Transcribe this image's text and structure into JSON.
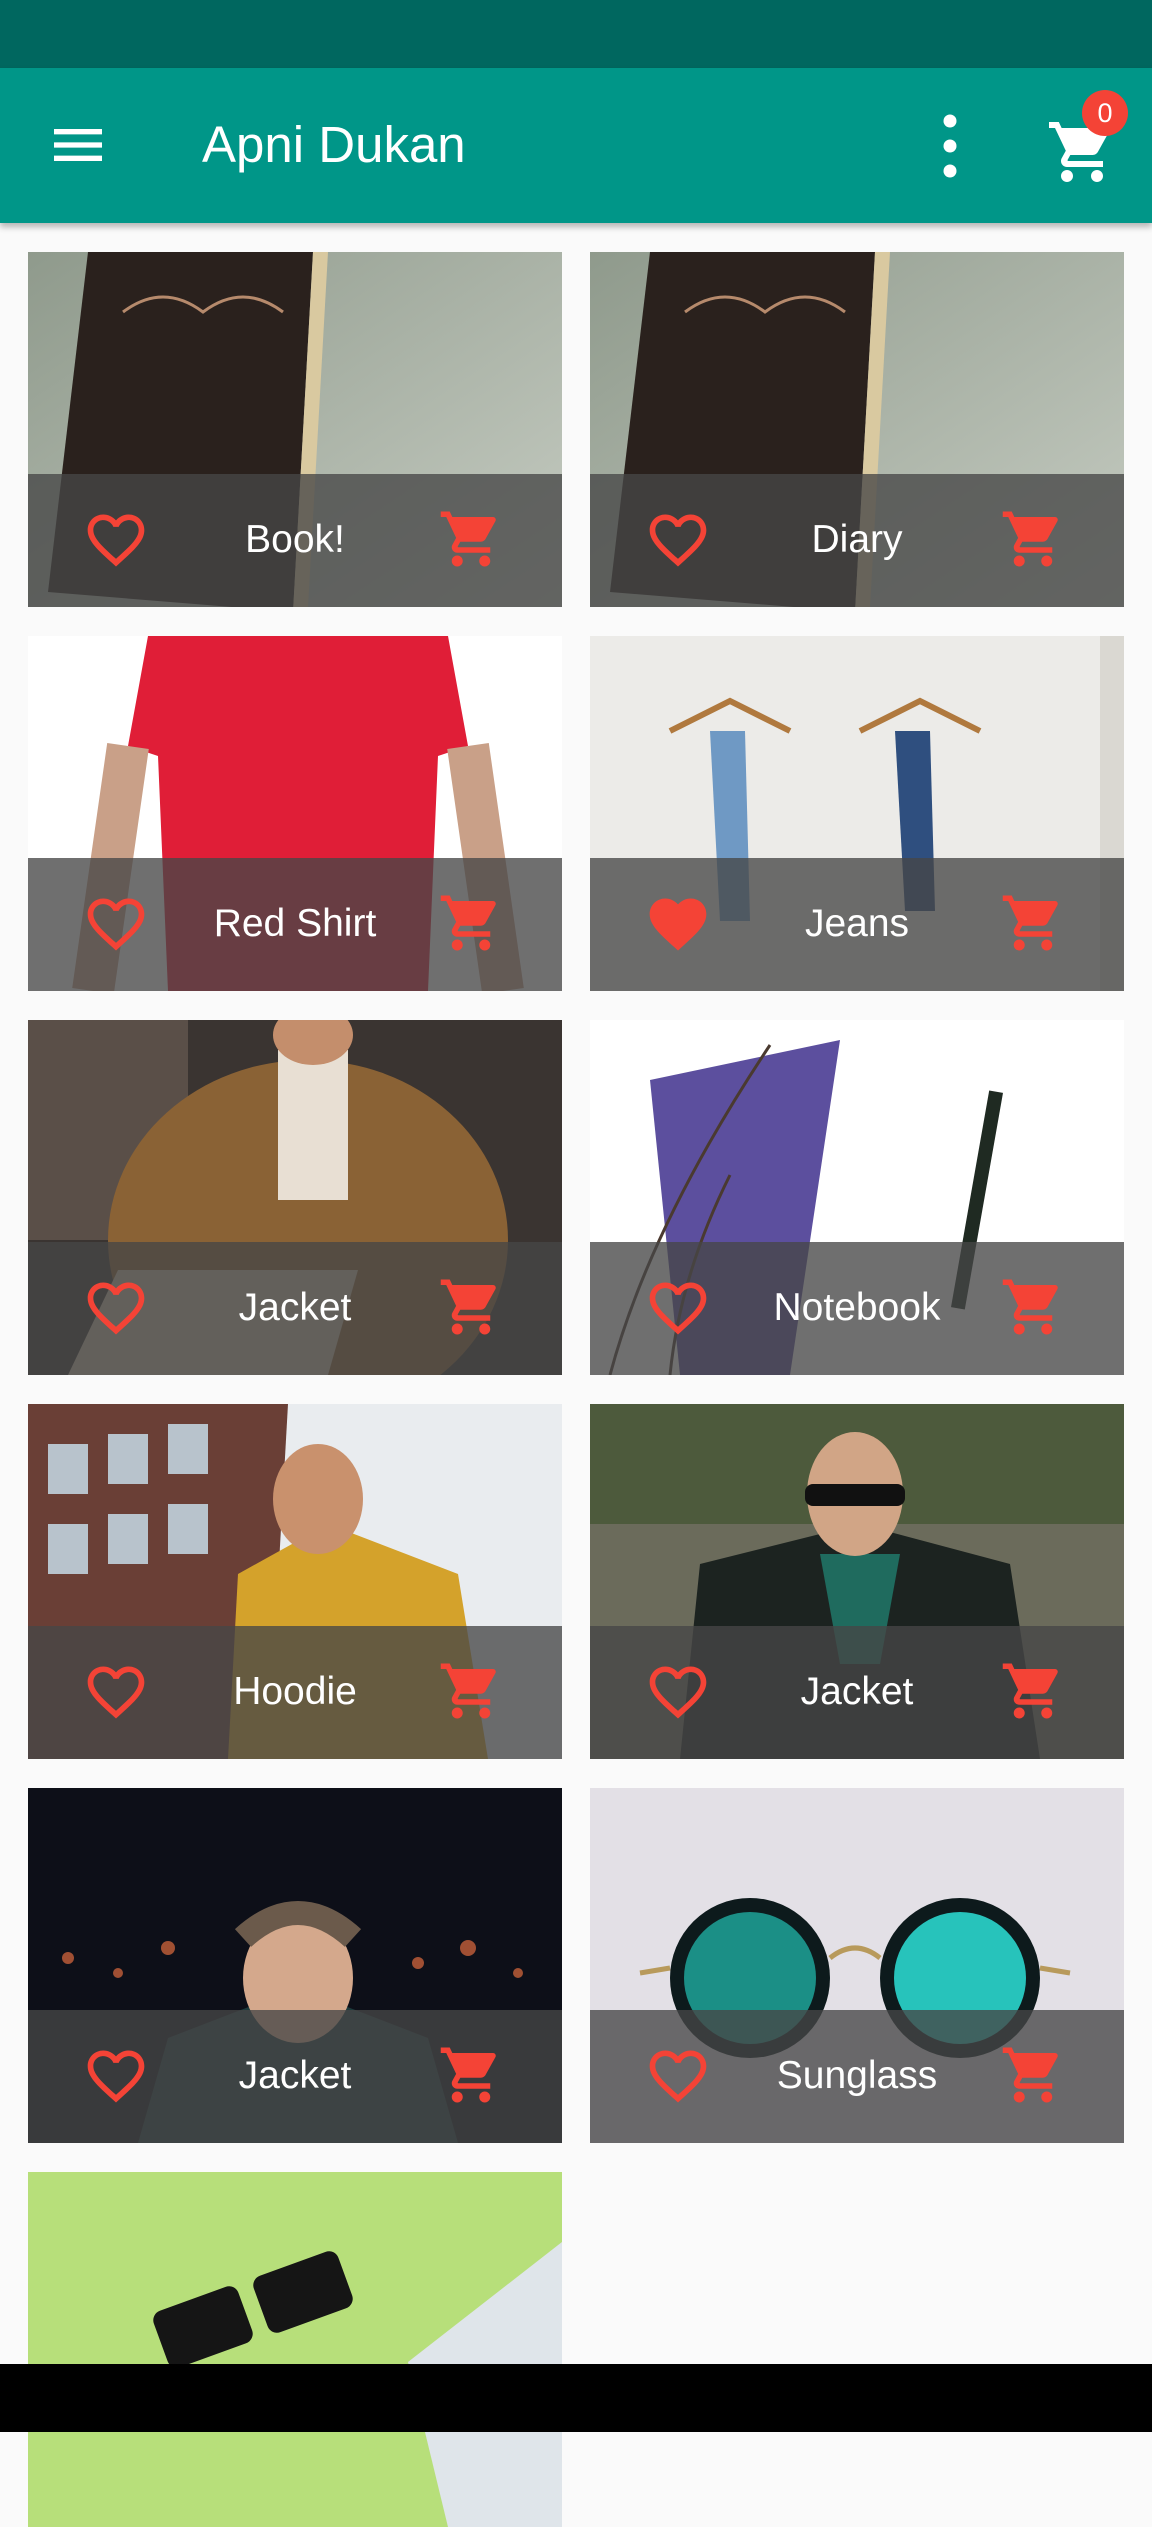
{
  "app": {
    "title": "Apni Dukan",
    "cart_count": "0",
    "colors": {
      "primary": "#009688",
      "primary_dark": "#00675f",
      "accent": "#f44336"
    }
  },
  "products": [
    {
      "label": "Book!",
      "favorited": false,
      "image": "leather book on grey cloth"
    },
    {
      "label": "Diary",
      "favorited": false,
      "image": "leather book on grey cloth"
    },
    {
      "label": "Red Shirt",
      "favorited": false,
      "image": "red t-shirt"
    },
    {
      "label": "Jeans",
      "favorited": true,
      "image": "jeans on hangers"
    },
    {
      "label": "Jacket",
      "favorited": false,
      "image": "fur jacket"
    },
    {
      "label": "Notebook",
      "favorited": false,
      "image": "purple notebook and pen"
    },
    {
      "label": "Hoodie",
      "favorited": false,
      "image": "yellow hoodie"
    },
    {
      "label": "Jacket",
      "favorited": false,
      "image": "black leather jacket"
    },
    {
      "label": "Jacket",
      "favorited": false,
      "image": "dark jacket at night"
    },
    {
      "label": "Sunglass",
      "favorited": false,
      "image": "round sunglasses"
    },
    {
      "label": "",
      "favorited": false,
      "image": "square sunglasses on green"
    }
  ]
}
